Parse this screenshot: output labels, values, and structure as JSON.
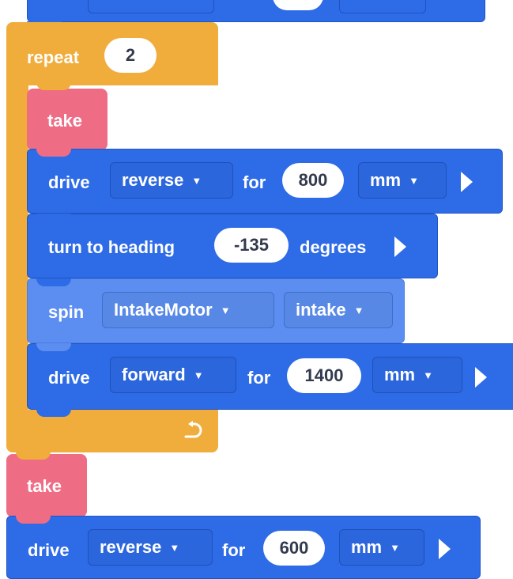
{
  "blocks": {
    "repeat": {
      "label": "repeat",
      "count": "2",
      "loop_icon": "loop-arrow-icon"
    },
    "take1": {
      "label": "take"
    },
    "drive1": {
      "label": "drive",
      "direction": "reverse",
      "for_label": "for",
      "distance": "800",
      "unit": "mm"
    },
    "turn": {
      "label": "turn to heading",
      "heading": "-135",
      "unit_label": "degrees"
    },
    "spin": {
      "label": "spin",
      "motor": "IntakeMotor",
      "mode": "intake"
    },
    "drive2": {
      "label": "drive",
      "direction": "forward",
      "for_label": "for",
      "distance": "1400",
      "unit": "mm"
    },
    "take2": {
      "label": "take"
    },
    "drive3": {
      "label": "drive",
      "direction": "reverse",
      "for_label": "for",
      "distance": "600",
      "unit": "mm"
    }
  },
  "colors": {
    "motion": "#2e6be6",
    "motion_light": "#5b8ef0",
    "control": "#f0ad3c",
    "take": "#ee6d85"
  }
}
